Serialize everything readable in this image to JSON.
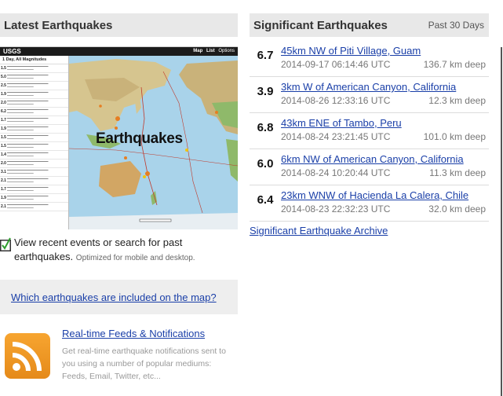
{
  "latest": {
    "title": "Latest Earthquakes",
    "map": {
      "logo": "USGS",
      "tab_map": "Map",
      "tab_list": "List",
      "tab_options": "Options",
      "list_title": "1 Day, All Magnitudes",
      "list_mags": [
        "1.5",
        "5.0",
        "2.5",
        "1.9",
        "2.0",
        "6.2",
        "1.7",
        "1.9",
        "1.5",
        "1.5",
        "1.4",
        "2.0",
        "3.1",
        "2.1",
        "1.7",
        "1.9",
        "2.1"
      ],
      "overlay_label": "Earthquakes"
    },
    "check_text": "View recent events or search for past earthquakes.",
    "check_small": "Optimized for mobile and desktop.",
    "which_link": "Which earthquakes are included on the map?",
    "feeds_link": "Real-time Feeds & Notifications",
    "feeds_desc": "Get real-time earthquake notifications sent to you using a number of popular mediums: Feeds, Email, Twitter, etc..."
  },
  "significant": {
    "title": "Significant Earthquakes",
    "subtitle": "Past 30 Days",
    "events": [
      {
        "mag": "6.7",
        "place": "45km NW of Piti Village, Guam",
        "time": "2014-09-17 06:14:46 UTC",
        "depth": "136.7 km deep"
      },
      {
        "mag": "3.9",
        "place": "3km W of American Canyon, California",
        "time": "2014-08-26 12:33:16 UTC",
        "depth": "12.3 km deep"
      },
      {
        "mag": "6.8",
        "place": "43km ENE of Tambo, Peru",
        "time": "2014-08-24 23:21:45 UTC",
        "depth": "101.0 km deep"
      },
      {
        "mag": "6.0",
        "place": "6km NW of American Canyon, California",
        "time": "2014-08-24 10:20:44 UTC",
        "depth": "11.3 km deep"
      },
      {
        "mag": "6.4",
        "place": "23km WNW of Hacienda La Calera, Chile",
        "time": "2014-08-23 22:32:23 UTC",
        "depth": "32.0 km deep"
      }
    ],
    "archive_link": "Significant Earthquake Archive"
  },
  "colors": {
    "link": "#1a3fa8",
    "header_bg": "#e8e8e8",
    "rss": "#f29b26"
  },
  "icons": {
    "check": "checkbox-checked-icon",
    "rss": "rss-feed-icon"
  }
}
